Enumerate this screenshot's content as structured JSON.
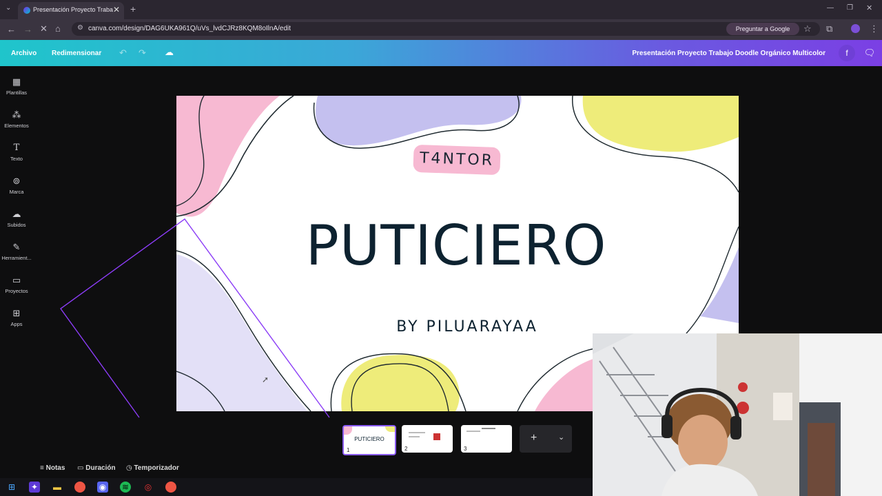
{
  "browser": {
    "tab_title": "Presentación Proyecto Trabajo Doodle Orgánico Multicolor",
    "tab_close": "✕",
    "new_tab": "+",
    "url": "canva.com/design/DAG6UKA961Q/uVs_lvdCJRz8KQM8oIlnA/edit",
    "google_button": "Preguntar a Google"
  },
  "header": {
    "file_menu": "Archivo",
    "resize_menu": "Redimensionar",
    "doc_title": "Presentación Proyecto Trabajo Doodle Orgánico Multicolor",
    "avatar_initial": "f"
  },
  "sidebar": {
    "items": [
      {
        "label": "Plantillas",
        "icon": "templates-icon"
      },
      {
        "label": "Elementos",
        "icon": "elements-icon"
      },
      {
        "label": "Texto",
        "icon": "text-icon"
      },
      {
        "label": "Marca",
        "icon": "brand-icon"
      },
      {
        "label": "Subidos",
        "icon": "uploads-icon"
      },
      {
        "label": "Herramient...",
        "icon": "tools-icon"
      },
      {
        "label": "Proyectos",
        "icon": "projects-icon"
      },
      {
        "label": "Apps",
        "icon": "apps-icon"
      }
    ]
  },
  "slide": {
    "badge": "T4NTOR",
    "title": "PUTICIERO",
    "subtitle": "BY PILUARAYAA"
  },
  "thumbnails": [
    {
      "number": "1",
      "text": "PUTICIERO"
    },
    {
      "number": "2",
      "text": ""
    },
    {
      "number": "3",
      "text": ""
    }
  ],
  "footer": {
    "notes": "Notas",
    "duration": "Duración",
    "timer": "Temporizador"
  },
  "colors": {
    "accent": "#8b5cf6",
    "slide_pink": "#f7b9d2",
    "slide_yellow": "#eeec7a",
    "slide_lavender": "#c4c0ef",
    "slide_text": "#0d2230"
  }
}
